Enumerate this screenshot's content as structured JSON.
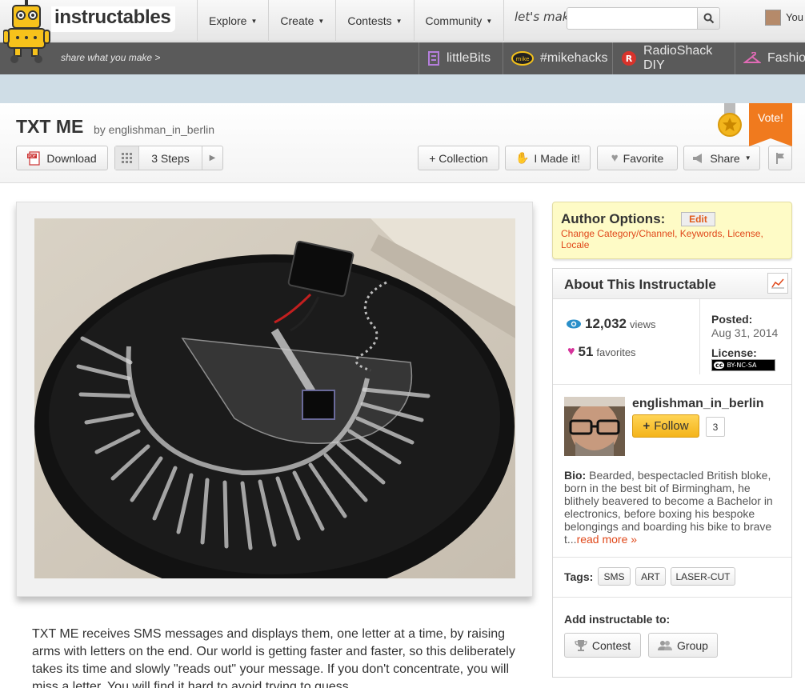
{
  "header": {
    "logo": "instructables",
    "nav": [
      {
        "label": "Explore"
      },
      {
        "label": "Create"
      },
      {
        "label": "Contests"
      },
      {
        "label": "Community"
      }
    ],
    "lets_make": "let's make",
    "search_placeholder": "",
    "user_label": "You"
  },
  "subbar": {
    "tagline": "share what you make >",
    "partners": [
      "littleBits",
      "#mikehacks",
      "RadioShack DIY",
      "Fashion"
    ]
  },
  "title_area": {
    "title": "TXT ME",
    "byline": "by englishman_in_berlin",
    "buttons": {
      "download": "Download",
      "steps": "3 Steps",
      "collection": "+ Collection",
      "made_it": "I Made it!",
      "favorite": "Favorite",
      "share": "Share"
    },
    "vote": "Vote!"
  },
  "intro_text": "TXT ME receives SMS messages and displays them, one letter at a time, by raising arms with letters on the end. Our world is getting faster and faster, so this deliberately takes its time and slowly \"reads out\" your message. If you don't concentrate, you will miss a letter. You will find it hard to avoid trying to guess",
  "sidebar": {
    "author_options": {
      "title": "Author Options:",
      "edit": "Edit",
      "links": "Change Category/Channel, Keywords, License, Locale"
    },
    "about": {
      "title": "About This Instructable",
      "views_count": "12,032",
      "views_label": "views",
      "favorites_count": "51",
      "favorites_label": "favorites",
      "posted_label": "Posted:",
      "posted_date": "Aug 31, 2014",
      "license_label": "License:",
      "license_badge": "BY-NC-SA",
      "author": "englishman_in_berlin",
      "follow": "Follow",
      "follow_count": "3",
      "bio_label": "Bio:",
      "bio_text": " Bearded, bespectacled British bloke, born in the best bit of Birmingham, he blithely beavered to become a Bachelor in electronics, before boxing his bespoke belongings and boarding his bike to brave t...",
      "read_more": "read more »",
      "tags_label": "Tags:",
      "tags": [
        "SMS",
        "ART",
        "LASER-CUT"
      ],
      "add_label": "Add instructable to:",
      "contest": "Contest",
      "group": "Group"
    }
  },
  "colors": {
    "accent_orange": "#f07a1e",
    "link_orange": "#e0481a",
    "author_options_bg": "#fefbc6",
    "follow_yellow": "#f4b41a",
    "subbar": "#5a5a5a"
  }
}
